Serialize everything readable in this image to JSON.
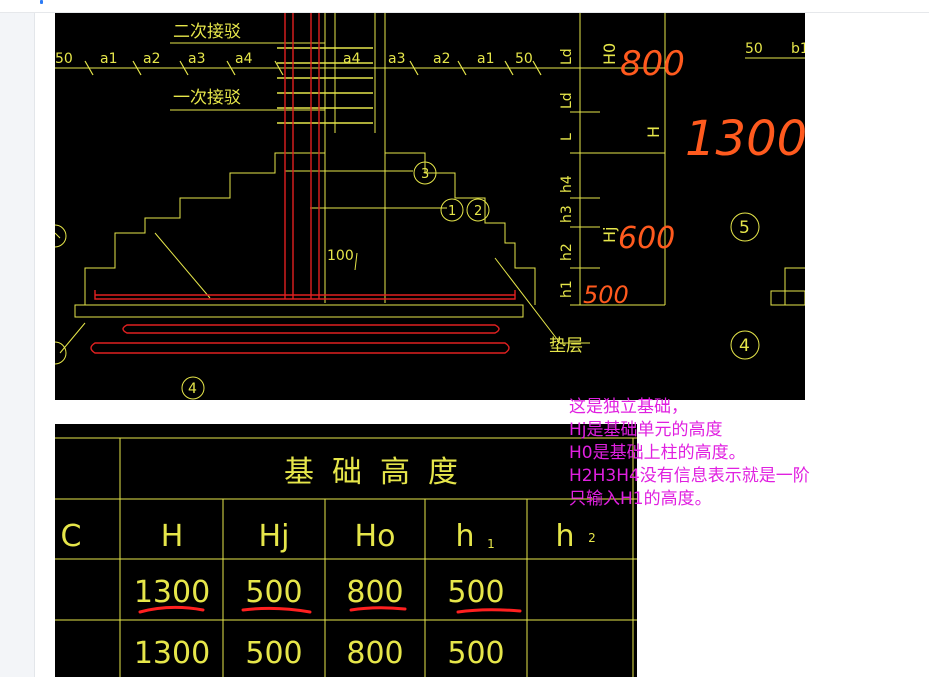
{
  "app": {
    "colors": {
      "cad_background": "#000000",
      "cad_lines": "#e6e64a",
      "rebar": "#e02020",
      "handwriting": "#ff5a1e",
      "annotation": "#e020e0",
      "app_background": "#ffffff",
      "sidebar": "#f3f5f8"
    }
  },
  "section_drawing": {
    "labels": {
      "second_splice": "二次接驳",
      "first_splice": "一次接驳",
      "dim_50": "50",
      "a1": "a1",
      "a2": "a2",
      "a3": "a3",
      "a4": "a4",
      "dim_100": "100",
      "cushion": "垫层",
      "marker_1": "1",
      "marker_2": "2",
      "marker_3": "3",
      "marker_4": "4",
      "marker_5": "5",
      "dim_b1": "b1"
    },
    "vertical_dims": {
      "ld": "Ld",
      "l": "L",
      "h1": "h1",
      "h2": "h2",
      "h3": "h3",
      "h4": "h4",
      "h0": "H0",
      "h": "H",
      "hj": "Hj"
    },
    "handwritten": {
      "h0_value": "800",
      "h_value": "1300",
      "hj_value": "600",
      "h1_value": "500"
    }
  },
  "height_table": {
    "title": "基础高度",
    "headers": [
      "C",
      "H",
      "Hj",
      "Ho",
      "h",
      "h"
    ],
    "header_subscripts": {
      "h1": "1",
      "h2": "2"
    },
    "rows": [
      [
        "",
        "1300",
        "500",
        "800",
        "500",
        ""
      ],
      [
        "",
        "1300",
        "500",
        "800",
        "500",
        ""
      ]
    ]
  },
  "annotation": {
    "lines": [
      "这是独立基础，",
      "Hj是基础单元的高度",
      "H0是基础上柱的高度。",
      "H2H3H4没有信息表示就是一阶",
      "只输入H1的高度。"
    ]
  }
}
